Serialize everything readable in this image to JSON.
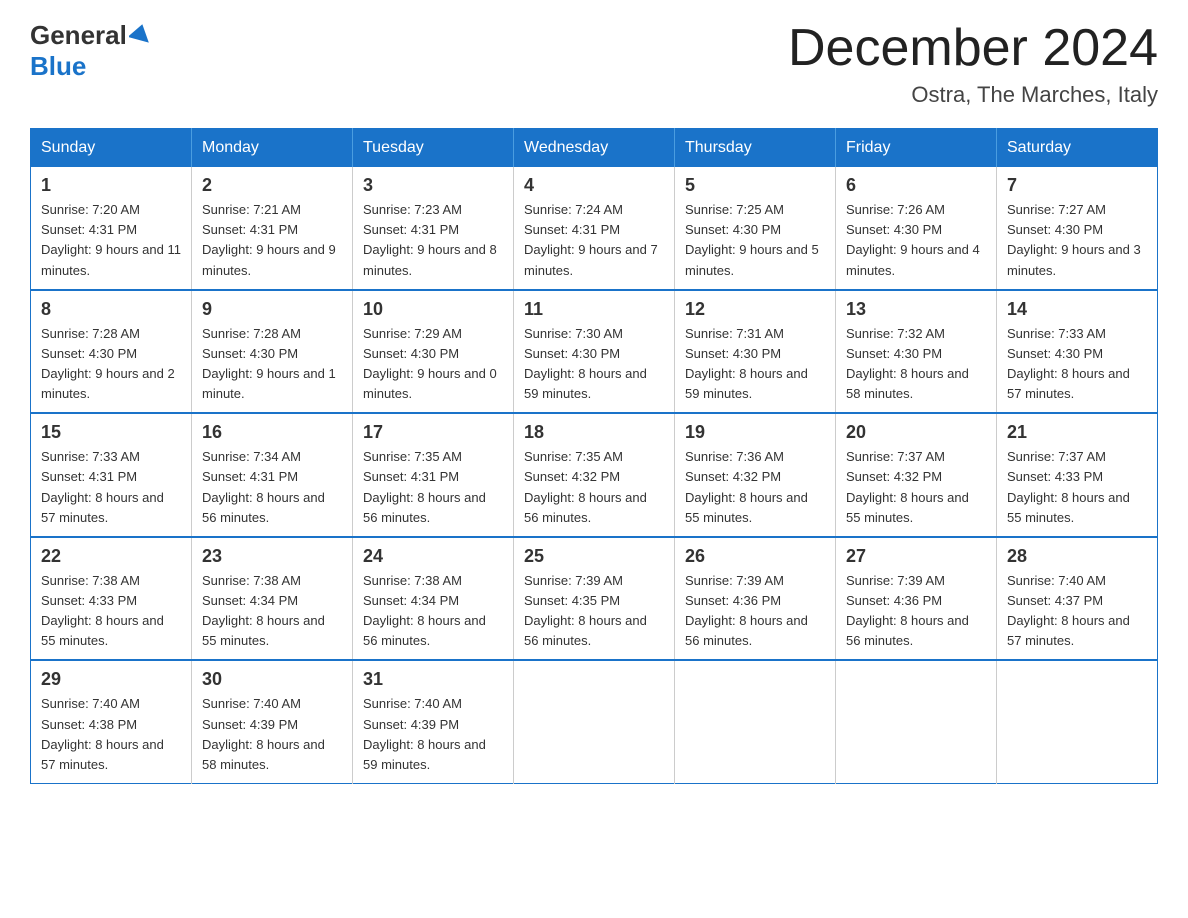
{
  "header": {
    "logo_general": "General",
    "logo_blue": "Blue",
    "month_title": "December 2024",
    "location": "Ostra, The Marches, Italy"
  },
  "days_of_week": [
    "Sunday",
    "Monday",
    "Tuesday",
    "Wednesday",
    "Thursday",
    "Friday",
    "Saturday"
  ],
  "weeks": [
    [
      {
        "num": "1",
        "sunrise": "7:20 AM",
        "sunset": "4:31 PM",
        "daylight": "9 hours and 11 minutes."
      },
      {
        "num": "2",
        "sunrise": "7:21 AM",
        "sunset": "4:31 PM",
        "daylight": "9 hours and 9 minutes."
      },
      {
        "num": "3",
        "sunrise": "7:23 AM",
        "sunset": "4:31 PM",
        "daylight": "9 hours and 8 minutes."
      },
      {
        "num": "4",
        "sunrise": "7:24 AM",
        "sunset": "4:31 PM",
        "daylight": "9 hours and 7 minutes."
      },
      {
        "num": "5",
        "sunrise": "7:25 AM",
        "sunset": "4:30 PM",
        "daylight": "9 hours and 5 minutes."
      },
      {
        "num": "6",
        "sunrise": "7:26 AM",
        "sunset": "4:30 PM",
        "daylight": "9 hours and 4 minutes."
      },
      {
        "num": "7",
        "sunrise": "7:27 AM",
        "sunset": "4:30 PM",
        "daylight": "9 hours and 3 minutes."
      }
    ],
    [
      {
        "num": "8",
        "sunrise": "7:28 AM",
        "sunset": "4:30 PM",
        "daylight": "9 hours and 2 minutes."
      },
      {
        "num": "9",
        "sunrise": "7:28 AM",
        "sunset": "4:30 PM",
        "daylight": "9 hours and 1 minute."
      },
      {
        "num": "10",
        "sunrise": "7:29 AM",
        "sunset": "4:30 PM",
        "daylight": "9 hours and 0 minutes."
      },
      {
        "num": "11",
        "sunrise": "7:30 AM",
        "sunset": "4:30 PM",
        "daylight": "8 hours and 59 minutes."
      },
      {
        "num": "12",
        "sunrise": "7:31 AM",
        "sunset": "4:30 PM",
        "daylight": "8 hours and 59 minutes."
      },
      {
        "num": "13",
        "sunrise": "7:32 AM",
        "sunset": "4:30 PM",
        "daylight": "8 hours and 58 minutes."
      },
      {
        "num": "14",
        "sunrise": "7:33 AM",
        "sunset": "4:30 PM",
        "daylight": "8 hours and 57 minutes."
      }
    ],
    [
      {
        "num": "15",
        "sunrise": "7:33 AM",
        "sunset": "4:31 PM",
        "daylight": "8 hours and 57 minutes."
      },
      {
        "num": "16",
        "sunrise": "7:34 AM",
        "sunset": "4:31 PM",
        "daylight": "8 hours and 56 minutes."
      },
      {
        "num": "17",
        "sunrise": "7:35 AM",
        "sunset": "4:31 PM",
        "daylight": "8 hours and 56 minutes."
      },
      {
        "num": "18",
        "sunrise": "7:35 AM",
        "sunset": "4:32 PM",
        "daylight": "8 hours and 56 minutes."
      },
      {
        "num": "19",
        "sunrise": "7:36 AM",
        "sunset": "4:32 PM",
        "daylight": "8 hours and 55 minutes."
      },
      {
        "num": "20",
        "sunrise": "7:37 AM",
        "sunset": "4:32 PM",
        "daylight": "8 hours and 55 minutes."
      },
      {
        "num": "21",
        "sunrise": "7:37 AM",
        "sunset": "4:33 PM",
        "daylight": "8 hours and 55 minutes."
      }
    ],
    [
      {
        "num": "22",
        "sunrise": "7:38 AM",
        "sunset": "4:33 PM",
        "daylight": "8 hours and 55 minutes."
      },
      {
        "num": "23",
        "sunrise": "7:38 AM",
        "sunset": "4:34 PM",
        "daylight": "8 hours and 55 minutes."
      },
      {
        "num": "24",
        "sunrise": "7:38 AM",
        "sunset": "4:34 PM",
        "daylight": "8 hours and 56 minutes."
      },
      {
        "num": "25",
        "sunrise": "7:39 AM",
        "sunset": "4:35 PM",
        "daylight": "8 hours and 56 minutes."
      },
      {
        "num": "26",
        "sunrise": "7:39 AM",
        "sunset": "4:36 PM",
        "daylight": "8 hours and 56 minutes."
      },
      {
        "num": "27",
        "sunrise": "7:39 AM",
        "sunset": "4:36 PM",
        "daylight": "8 hours and 56 minutes."
      },
      {
        "num": "28",
        "sunrise": "7:40 AM",
        "sunset": "4:37 PM",
        "daylight": "8 hours and 57 minutes."
      }
    ],
    [
      {
        "num": "29",
        "sunrise": "7:40 AM",
        "sunset": "4:38 PM",
        "daylight": "8 hours and 57 minutes."
      },
      {
        "num": "30",
        "sunrise": "7:40 AM",
        "sunset": "4:39 PM",
        "daylight": "8 hours and 58 minutes."
      },
      {
        "num": "31",
        "sunrise": "7:40 AM",
        "sunset": "4:39 PM",
        "daylight": "8 hours and 59 minutes."
      },
      null,
      null,
      null,
      null
    ]
  ]
}
